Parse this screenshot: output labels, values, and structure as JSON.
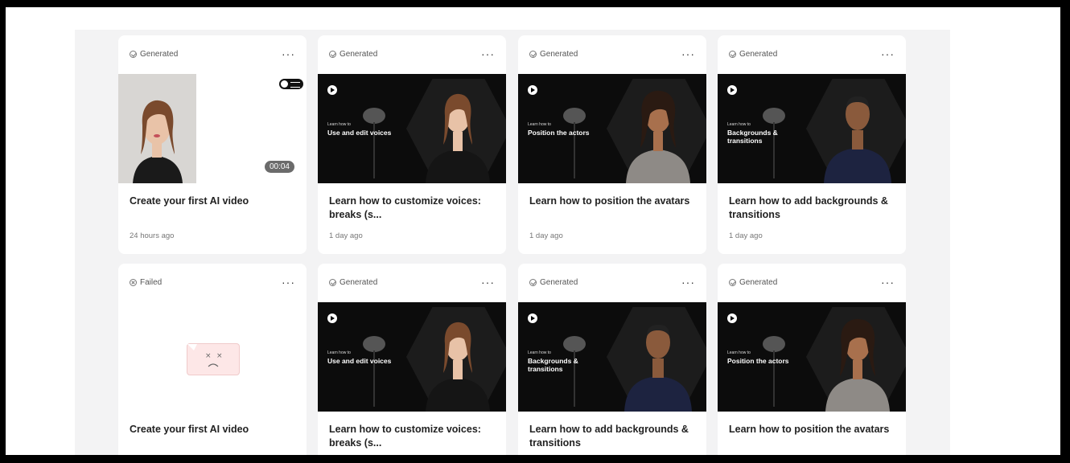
{
  "cards": [
    {
      "status": "Generated",
      "status_kind": "check",
      "title": "Create your first AI video",
      "date": "24 hours ago",
      "thumb": "portrait",
      "duration": "00:04"
    },
    {
      "status": "Generated",
      "status_kind": "check",
      "title": "Learn how to customize voices: breaks (s...",
      "date": "1 day ago",
      "thumb": "dark",
      "learn_small": "Learn how to",
      "learn_big": "Use and edit voices",
      "person": "woman-blazer"
    },
    {
      "status": "Generated",
      "status_kind": "check",
      "title": "Learn how to position the avatars",
      "date": "1 day ago",
      "thumb": "dark",
      "learn_small": "Learn how to",
      "learn_big": "Position the actors",
      "person": "woman-grey"
    },
    {
      "status": "Generated",
      "status_kind": "check",
      "title": "Learn how to add backgrounds & transitions",
      "date": "1 day ago",
      "thumb": "dark",
      "learn_small": "Learn how to",
      "learn_big": "Backgrounds & transitions",
      "person": "man-navy"
    },
    {
      "status": "Failed",
      "status_kind": "x",
      "title": "Create your first AI video",
      "date": "",
      "thumb": "failed"
    },
    {
      "status": "Generated",
      "status_kind": "check",
      "title": "Learn how to customize voices: breaks (s...",
      "date": "",
      "thumb": "dark",
      "learn_small": "Learn how to",
      "learn_big": "Use and edit voices",
      "person": "woman-blazer"
    },
    {
      "status": "Generated",
      "status_kind": "check",
      "title": "Learn how to add backgrounds & transitions",
      "date": "",
      "thumb": "dark",
      "learn_small": "Learn how to",
      "learn_big": "Backgrounds & transitions",
      "person": "man-navy"
    },
    {
      "status": "Generated",
      "status_kind": "check",
      "title": "Learn how to position the avatars",
      "date": "",
      "thumb": "dark",
      "learn_small": "Learn how to",
      "learn_big": "Position the actors",
      "person": "woman-grey"
    }
  ],
  "more_label": "···",
  "icons": {
    "status_generated": "check-circle-icon",
    "status_failed": "x-circle-icon",
    "more": "more-horizontal-icon",
    "play_logo": "play-logo-icon",
    "failed_face": "sad-face-icon"
  }
}
